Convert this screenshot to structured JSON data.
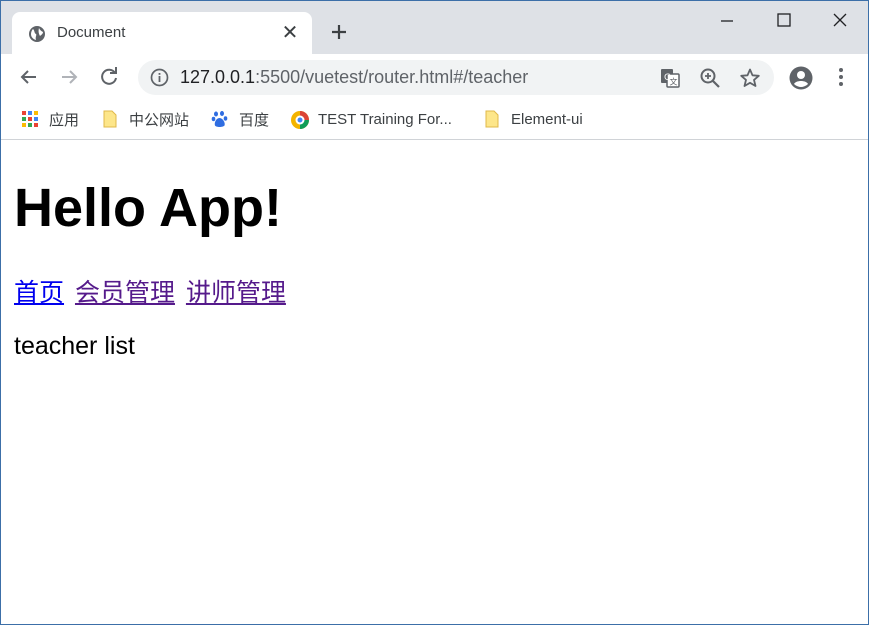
{
  "browser": {
    "tab": {
      "title": "Document",
      "favicon": "globe-icon",
      "close_label": "✕"
    },
    "new_tab_icon": "plus-icon",
    "window_controls": [
      "minimize-icon",
      "maximize-icon",
      "close-icon"
    ],
    "address_bar": {
      "host": "127.0.0.1",
      "path": ":5500/vuetest/router.html#/teacher"
    }
  },
  "bookmarks": [
    {
      "label": "应用",
      "icon": "apps-grid-icon"
    },
    {
      "label": "中公网站",
      "icon": "folder-icon"
    },
    {
      "label": "百度",
      "icon": "baidu-paw-icon"
    },
    {
      "label": "TEST Training For...",
      "icon": "site-logo-icon"
    },
    {
      "label": "Element-ui",
      "icon": "folder-icon"
    }
  ],
  "page": {
    "heading": "Hello App!",
    "nav_links": [
      "首页",
      "会员管理",
      "讲师管理"
    ],
    "view_text": "teacher list"
  },
  "colors": {
    "tabstrip_bg": "#dee1e6",
    "link": "#0000ee",
    "visited_link": "#551a8b"
  }
}
